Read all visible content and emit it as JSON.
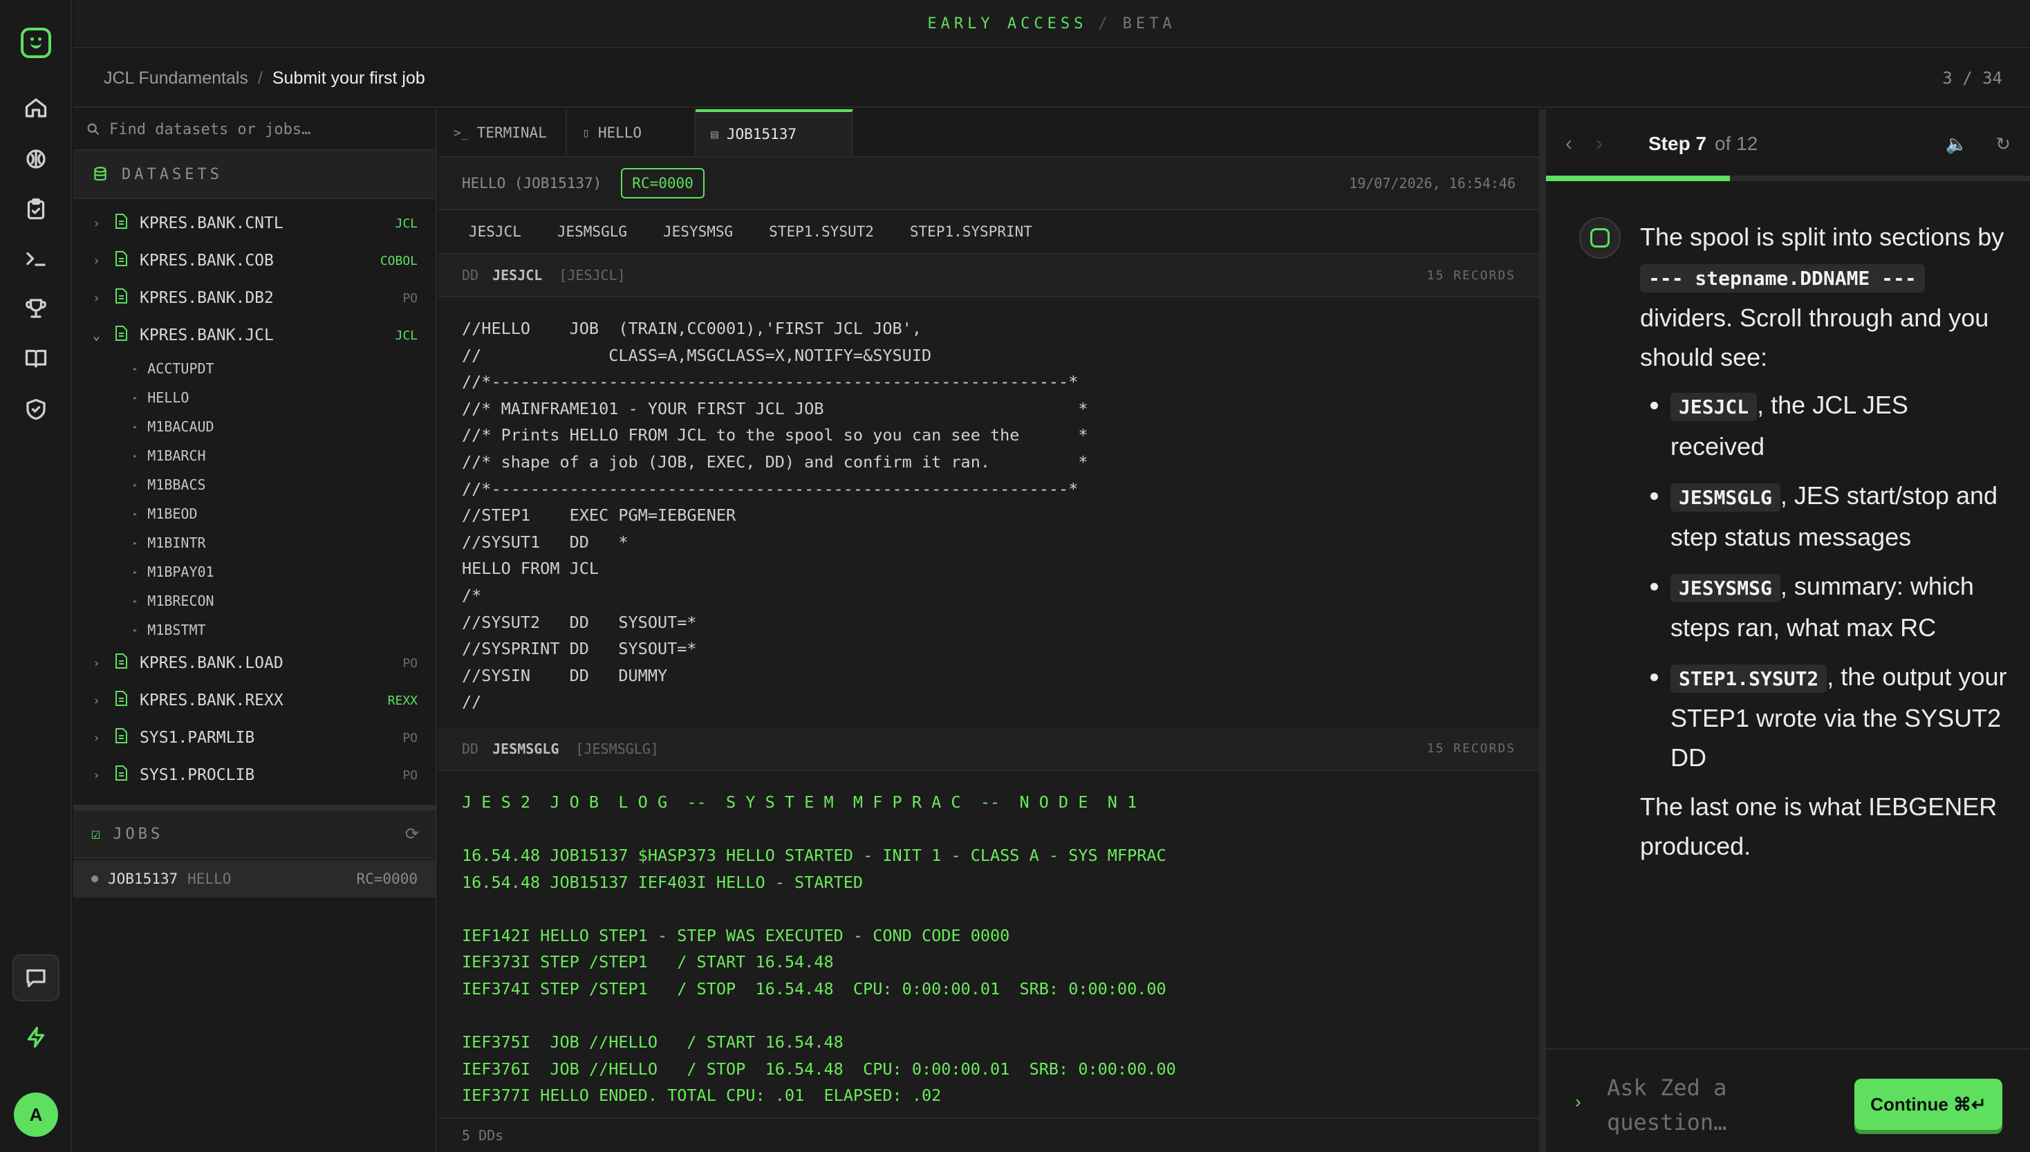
{
  "banner": {
    "left": "EARLY ACCESS",
    "sep": "/",
    "right": "BETA"
  },
  "breadcrumb": {
    "course": "JCL Fundamentals",
    "sep": "/",
    "lesson": "Submit your first job",
    "count": "3 / 34"
  },
  "rail": {
    "avatar": "A",
    "icons": [
      "home-icon",
      "brain-icon",
      "clipboard-icon",
      "terminal-icon",
      "trophy-icon",
      "book-icon",
      "shield-icon",
      "chat-icon",
      "bolt-icon"
    ]
  },
  "explorer": {
    "search_placeholder": "Find datasets or jobs…",
    "datasets_title": "DATASETS",
    "datasets": [
      {
        "name": "KPRES.BANK.CNTL",
        "tag": "JCL",
        "green": true,
        "open": false
      },
      {
        "name": "KPRES.BANK.COB",
        "tag": "COBOL",
        "green": true,
        "open": false
      },
      {
        "name": "KPRES.BANK.DB2",
        "tag": "PO",
        "green": false,
        "open": false
      },
      {
        "name": "KPRES.BANK.JCL",
        "tag": "JCL",
        "green": true,
        "open": true
      }
    ],
    "members": [
      "ACCTUPDT",
      "HELLO",
      "M1BACAUD",
      "M1BARCH",
      "M1BBACS",
      "M1BEOD",
      "M1BINTR",
      "M1BPAY01",
      "M1BRECON",
      "M1BSTMT"
    ],
    "datasets_after": [
      {
        "name": "KPRES.BANK.LOAD",
        "tag": "PO",
        "green": false
      },
      {
        "name": "KPRES.BANK.REXX",
        "tag": "REXX",
        "green": true
      },
      {
        "name": "SYS1.PARMLIB",
        "tag": "PO",
        "green": false
      },
      {
        "name": "SYS1.PROCLIB",
        "tag": "PO",
        "green": false
      }
    ],
    "jobs_title": "JOBS",
    "job": {
      "id": "JOB15137",
      "name": "HELLO",
      "rc": "RC=0000"
    }
  },
  "tabs": [
    {
      "label": "TERMINAL",
      "icon": ">_"
    },
    {
      "label": "HELLO",
      "icon": "▯"
    },
    {
      "label": "JOB15137",
      "icon": "▤"
    }
  ],
  "spool": {
    "title": "HELLO (JOB15137)",
    "rc": "RC=0000",
    "timestamp": "19/07/2026, 16:54:46",
    "dd_tabs": [
      "JESJCL",
      "JESMSGLG",
      "JESYSMSG",
      "STEP1.SYSUT2",
      "STEP1.SYSPRINT"
    ],
    "sections": [
      {
        "dd": "DD",
        "name": "JESJCL",
        "bracket": "[JESJCL]",
        "records": "15 RECORDS",
        "lines": [
          "//HELLO    JOB  (TRAIN,CC0001),'FIRST JCL JOB',",
          "//             CLASS=A,MSGCLASS=X,NOTIFY=&SYSUID",
          "//*-----------------------------------------------------------*",
          "//* MAINFRAME101 - YOUR FIRST JCL JOB                          *",
          "//* Prints HELLO FROM JCL to the spool so you can see the      *",
          "//* shape of a job (JOB, EXEC, DD) and confirm it ran.         *",
          "//*-----------------------------------------------------------*",
          "//STEP1    EXEC PGM=IEBGENER",
          "//SYSUT1   DD   *",
          "HELLO FROM JCL",
          "/*",
          "//SYSUT2   DD   SYSOUT=*",
          "//SYSPRINT DD   SYSOUT=*",
          "//SYSIN    DD   DUMMY",
          "//"
        ]
      },
      {
        "dd": "DD",
        "name": "JESMSGLG",
        "bracket": "[JESMSGLG]",
        "records": "15 RECORDS",
        "lines": [
          "J E S 2  J O B  L O G  --  S Y S T E M  M F P R A C  --  N O D E  N 1",
          "",
          "16.54.48 JOB15137 $HASP373 HELLO STARTED - INIT 1 - CLASS A - SYS MFPRAC",
          "16.54.48 JOB15137 IEF403I HELLO - STARTED",
          "",
          "IEF142I HELLO STEP1 - STEP WAS EXECUTED - COND CODE 0000",
          "IEF373I STEP /STEP1   / START 16.54.48",
          "IEF374I STEP /STEP1   / STOP  16.54.48  CPU: 0:00:00.01  SRB: 0:00:00.00",
          "",
          "IEF375I  JOB //HELLO   / START 16.54.48",
          "IEF376I  JOB //HELLO   / STOP  16.54.48  CPU: 0:00:00.01  SRB: 0:00:00.00",
          "IEF377I HELLO ENDED. TOTAL CPU: .01  ELAPSED: .02"
        ]
      }
    ],
    "footer": "5 DDs"
  },
  "guide": {
    "step": "Step 7",
    "of": "of 12",
    "progress": 0.38,
    "intro_before": "The spool is split into sections by ",
    "intro_code": "--- stepname.DDNAME ---",
    "intro_after": " dividers. Scroll through and you should see:",
    "bullets": [
      {
        "code": "JESJCL",
        "text": ", the JCL JES received"
      },
      {
        "code": "JESMSGLG",
        "text": ", JES start/stop and step status messages"
      },
      {
        "code": "JESYSMSG",
        "text": ", summary: which steps ran, what max RC"
      },
      {
        "code": "STEP1.SYSUT2",
        "text": ", the output your STEP1 wrote via the SYSUT2 DD"
      }
    ],
    "outro": "The last one is what IEBGENER produced.",
    "ask_placeholder": "Ask Zed a question…",
    "continue_label": "Continue ⌘↵"
  }
}
